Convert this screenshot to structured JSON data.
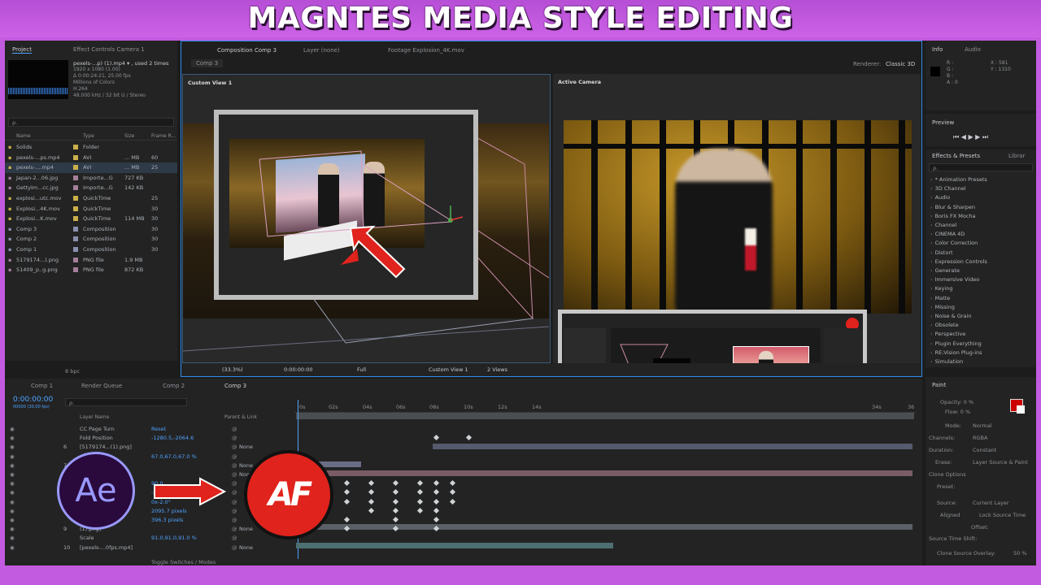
{
  "title": "MAGNTES MEDIA STYLE EDITING",
  "project": {
    "tabs": [
      "Project",
      "Effect Controls Camera 1"
    ],
    "file_name": "pexels-...p) (1).mp4 ▾ , used 2 times",
    "file_info": [
      "1920 x 1080 (1.00)",
      "Δ 0:00:24:21, 25.00 fps",
      "Millions of Colors",
      "H.264",
      "48.000 kHz / 32 bit U / Stereo"
    ],
    "search_placeholder": "ρ.",
    "columns": [
      "Name",
      "Type",
      "Size",
      "Frame R..."
    ],
    "items": [
      {
        "name": "Solids",
        "type": "Folder",
        "size": "",
        "rate": "",
        "color": "#c9b04a"
      },
      {
        "name": "pexels-...ps.mp4",
        "type": "AVI",
        "size": "... MB",
        "rate": "60",
        "color": "#c9b04a"
      },
      {
        "name": "pexels-....mp4",
        "type": "AVI",
        "size": "... MB",
        "rate": "25",
        "color": "#c9b04a"
      },
      {
        "name": "Japan-2...06.jpg",
        "type": "Importe...G",
        "size": "727 KB",
        "rate": "",
        "color": "#a47f9a"
      },
      {
        "name": "GettyIm...cc.jpg",
        "type": "Importe...G",
        "size": "142 KB",
        "rate": "",
        "color": "#a47f9a"
      },
      {
        "name": "explosi...utc.mov",
        "type": "QuickTime",
        "size": "",
        "rate": "25",
        "color": "#c9b04a"
      },
      {
        "name": "Explosi...4K.mov",
        "type": "QuickTime",
        "size": "",
        "rate": "30",
        "color": "#c9b04a"
      },
      {
        "name": "Explosi...K.mov",
        "type": "QuickTime",
        "size": "114 MB",
        "rate": "30",
        "color": "#c9b04a"
      },
      {
        "name": "Comp 3",
        "type": "Composition",
        "size": "",
        "rate": "30",
        "color": "#8a8fb0"
      },
      {
        "name": "Comp 2",
        "type": "Composition",
        "size": "",
        "rate": "30",
        "color": "#8a8fb0"
      },
      {
        "name": "Comp 1",
        "type": "Composition",
        "size": "",
        "rate": "30",
        "color": "#8a8fb0"
      },
      {
        "name": "5179174...).png",
        "type": "PNG file",
        "size": "1.9 MB",
        "rate": "",
        "color": "#a47f9a"
      },
      {
        "name": "51409_p..g.png",
        "type": "PNG file",
        "size": "872 KB",
        "rate": "",
        "color": "#a47f9a"
      }
    ],
    "bpc": "8 bpc"
  },
  "comp_header": {
    "tabs": [
      "Composition Comp 3",
      "Layer (none)",
      "Footage Explosion_4K.mov"
    ],
    "active_tab": "Comp 3",
    "renderer_label": "Renderer:",
    "renderer": "Classic 3D",
    "left_view": "Custom View 1",
    "right_view": "Active Camera"
  },
  "viewer_footer": {
    "zoom": "(33.3%)",
    "timecode": "0:00:00:00",
    "resolution": "Full",
    "view": "Custom View 1",
    "views": "2 Views"
  },
  "info": {
    "tabs": [
      "Info",
      "Audio"
    ],
    "rgba": [
      "R :",
      "G :",
      "B :",
      "A : 0"
    ],
    "x": "X : 581",
    "y": "Y : 1310"
  },
  "preview": {
    "label": "Preview"
  },
  "effects": {
    "tabs": [
      "Effects & Presets",
      "Librar"
    ],
    "search_placeholder": "ρ.",
    "items": [
      "* Animation Presets",
      "3D Channel",
      "Audio",
      "Blur & Sharpen",
      "Boris FX Mocha",
      "Channel",
      "CINEMA 4D",
      "Color Correction",
      "Distort",
      "Expression Controls",
      "Generate",
      "Immersive Video",
      "Keying",
      "Matte",
      "Missing",
      "Noise & Grain",
      "Obsolete",
      "Perspective",
      "Plugin Everything",
      "RE:Vision Plug-ins",
      "Simulation"
    ]
  },
  "paint": {
    "label": "Paint",
    "opacity": "Opacity: 0 %",
    "flow": "Flow: 0 %",
    "fields": [
      "Mode:",
      "Channels:",
      "Duration:",
      "Erase:"
    ],
    "values": [
      "Normal",
      "RGBA",
      "Constant",
      "Layer Source & Paint"
    ],
    "clone_options": "Clone Options",
    "preset": "Preset:",
    "source": "Source:",
    "source_value": "Current Layer",
    "aligned": "Aligned",
    "lock_source_time": "Lock Source Time",
    "offset": "Offset:",
    "source_time_shift": "Source Time Shift:",
    "clone_overlay": "Clone Source Overlay:",
    "overlay_value": "50 %"
  },
  "timeline": {
    "tabs": [
      "Comp 1",
      "Render Queue",
      "Comp 2",
      "Comp 3"
    ],
    "timecode": "0:00:00:00",
    "fps": "00000 (30.00 fps)",
    "search_placeholder": "ρ.",
    "columns": [
      "Layer Name",
      "Parent & Link"
    ],
    "ruler": [
      "0s",
      "02s",
      "04s",
      "06s",
      "08s",
      "10s",
      "12s",
      "14s",
      "34s",
      "36"
    ],
    "layers": [
      {
        "num": "",
        "name": "CC Page Turn",
        "value": "Reset",
        "parent": ""
      },
      {
        "num": "",
        "name": "Fold Position",
        "value": "-1280.5,-2064.6",
        "parent": ""
      },
      {
        "num": "6",
        "name": "[5179174...(1).png]",
        "value": "",
        "parent": "None"
      },
      {
        "num": "",
        "name": "",
        "value": "67.0,67.0,67.0 %",
        "parent": ""
      },
      {
        "num": "7",
        "name": ".png]",
        "value": "",
        "parent": "None"
      },
      {
        "num": "8",
        "name": "",
        "value": "",
        "parent": "None"
      },
      {
        "num": "",
        "name": "",
        "value": "90.0",
        "parent": ""
      },
      {
        "num": "",
        "name": "",
        "value": "-27.5",
        "parent": ""
      },
      {
        "num": "",
        "name": "",
        "value": "0x-2.0°",
        "parent": ""
      },
      {
        "num": "",
        "name": "",
        "value": "2095.7 pixels",
        "parent": ""
      },
      {
        "num": "",
        "name": "",
        "value": "396.3 pixels",
        "parent": ""
      },
      {
        "num": "9",
        "name": "(1).png]",
        "value": "",
        "parent": "None"
      },
      {
        "num": "",
        "name": "Scale",
        "value": "91.0,91.0,91.0 %",
        "parent": ""
      },
      {
        "num": "10",
        "name": "[pexels-...0fps.mp4]",
        "value": "",
        "parent": "None"
      }
    ],
    "toggle_label": "Toggle Switches / Modes"
  },
  "overlay": {
    "ae_logo": "Ae",
    "af_logo": "AF"
  },
  "colors": {
    "accent_blue": "#2d8ceb",
    "brand_purple": "#c35be0",
    "arrow_red": "#e0231c",
    "ae_purple": "#9999ff",
    "ae_bg": "#2a0a3d"
  }
}
